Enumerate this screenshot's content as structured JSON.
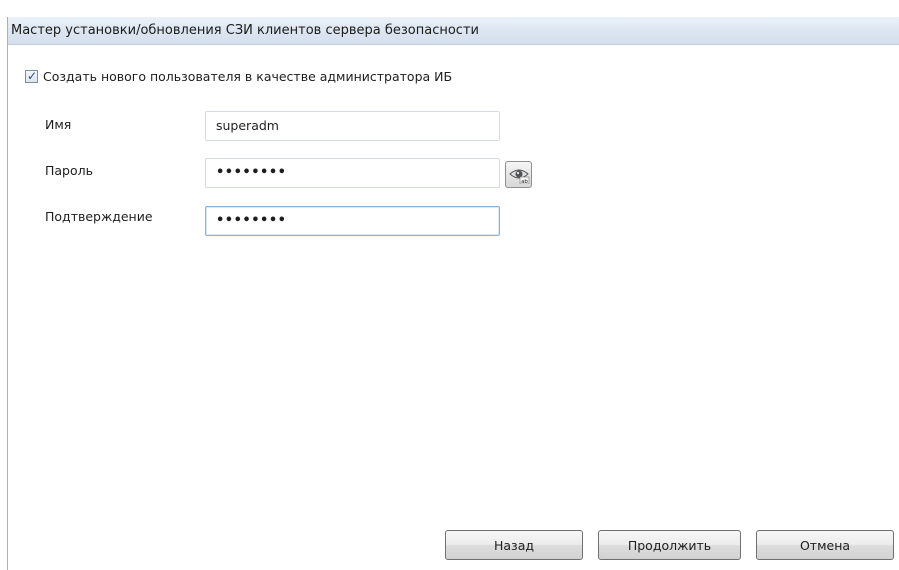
{
  "dialog": {
    "title": "Мастер установки/обновления СЗИ клиентов сервера безопасности"
  },
  "create_admin": {
    "label": "Создать нового пользователя в качестве администратора ИБ",
    "checked": true
  },
  "form": {
    "name_label": "Имя",
    "name_value": "superadm",
    "password_label": "Пароль",
    "password_value": "••••••••",
    "confirm_label": "Подтверждение",
    "confirm_value": "••••••••",
    "show_password_icon": "eye-icon"
  },
  "buttons": {
    "back": "Назад",
    "continue": "Продолжить",
    "cancel": "Отмена"
  }
}
